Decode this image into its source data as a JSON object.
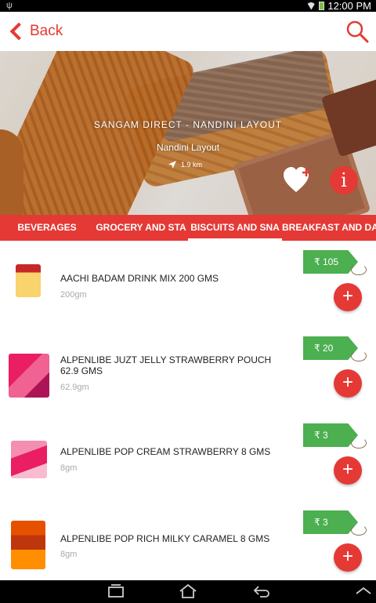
{
  "status_bar": {
    "time": "12:00 PM"
  },
  "header": {
    "back_label": "Back"
  },
  "store": {
    "name": "SANGAM DIRECT - NANDINI LAYOUT",
    "area": "Nandini Layout",
    "distance": "1.9 km"
  },
  "tabs": [
    {
      "label": "BEVERAGES"
    },
    {
      "label": "GROCERY AND STA"
    },
    {
      "label": "BISCUITS AND SNA",
      "active": true
    },
    {
      "label": "BREAKFAST AND DA"
    }
  ],
  "products": [
    {
      "name": "AACHI BADAM DRINK MIX 200 GMS",
      "quantity": "200gm",
      "price": "₹ 105"
    },
    {
      "name": "ALPENLIBE JUZT JELLY STRAWBERRY POUCH 62.9 GMS",
      "quantity": "62.9gm",
      "price": "₹ 20"
    },
    {
      "name": "ALPENLIBE POP CREAM STRAWBERRY 8 GMS",
      "quantity": "8gm",
      "price": "₹ 3"
    },
    {
      "name": "ALPENLIBE POP RICH MILKY CARAMEL 8 GMS",
      "quantity": "8gm",
      "price": "₹ 3"
    }
  ],
  "buttons": {
    "add": "+",
    "info": "i"
  },
  "colors": {
    "accent": "#e53935",
    "price_tag": "#4caf50"
  },
  "icons": {
    "search": "search-icon",
    "favorite": "heart-plus-icon",
    "recent": "recent-apps-icon",
    "home": "home-icon",
    "back": "back-icon",
    "up": "chevron-up-icon"
  }
}
